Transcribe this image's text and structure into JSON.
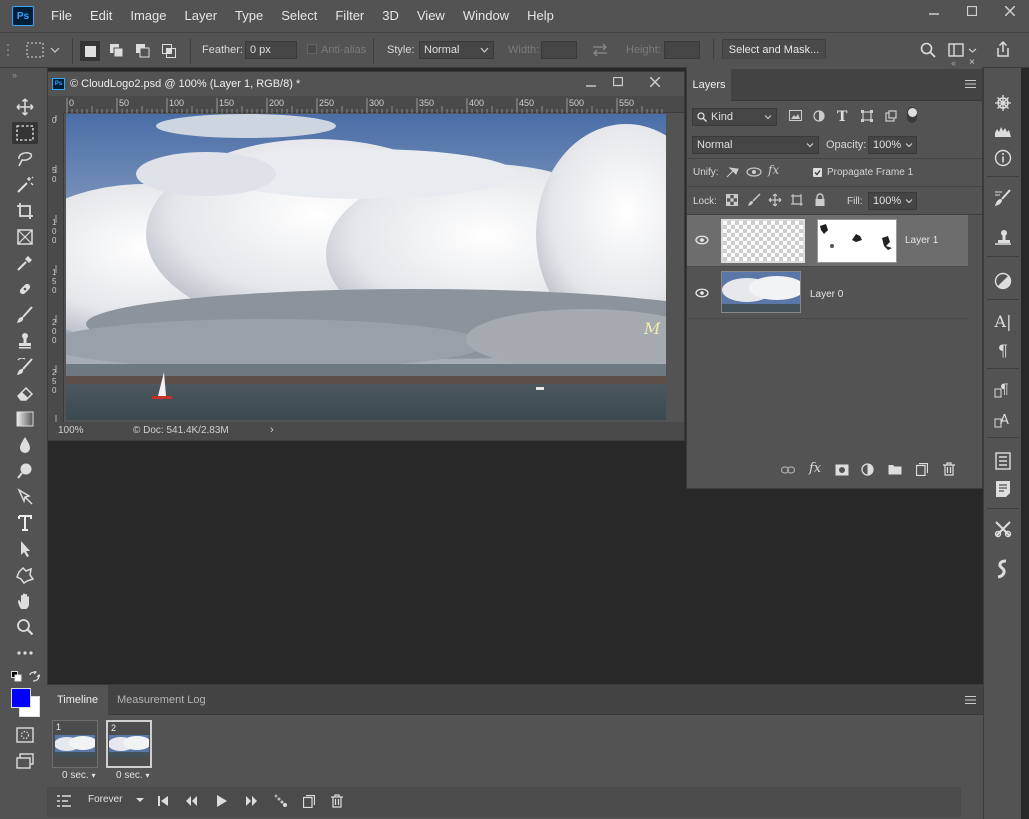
{
  "menu": [
    "File",
    "Edit",
    "Image",
    "Layer",
    "Type",
    "Select",
    "Filter",
    "3D",
    "View",
    "Window",
    "Help"
  ],
  "app_logo": "Ps",
  "options": {
    "feather_label": "Feather:",
    "feather_value": "0 px",
    "anti_alias": "Anti-alias",
    "style_label": "Style:",
    "style_value": "Normal",
    "width_label": "Width:",
    "height_label": "Height:",
    "select_mask": "Select and Mask..."
  },
  "document": {
    "title": "© CloudLogo2.psd @ 100% (Layer 1, RGB/8) *",
    "ruler_labels": [
      "0",
      "50",
      "100",
      "150",
      "200",
      "250",
      "300",
      "350",
      "400",
      "450",
      "500",
      "550"
    ],
    "zoom": "100%",
    "doc_info": "© Doc: 541.4K/2.83M"
  },
  "layers": {
    "tab": "Layers",
    "kind": "Kind",
    "blend_mode": "Normal",
    "opacity_label": "Opacity:",
    "opacity_value": "100%",
    "unify_label": "Unify:",
    "propagate_label": "Propagate Frame 1",
    "lock_label": "Lock:",
    "fill_label": "Fill:",
    "fill_value": "100%",
    "items": [
      {
        "name": "Layer 1",
        "selected": true
      },
      {
        "name": "Layer 0",
        "selected": false
      }
    ]
  },
  "timeline": {
    "tabs": [
      "Timeline",
      "Measurement Log"
    ],
    "frames": [
      {
        "number": "1",
        "delay": "0 sec."
      },
      {
        "number": "2",
        "delay": "0 sec."
      }
    ],
    "loop": "Forever"
  },
  "colors": {
    "foreground": "#0000ff",
    "background": "#ffffff",
    "panel": "#535353",
    "workspace": "#282828"
  }
}
